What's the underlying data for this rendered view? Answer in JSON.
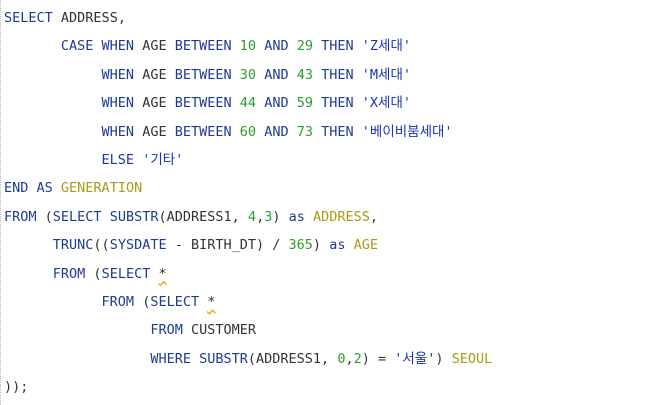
{
  "editor": {
    "lines": [
      [
        {
          "t": "SELECT",
          "c": "kw"
        },
        {
          "t": " ",
          "c": "op"
        },
        {
          "t": "ADDRESS",
          "c": "id"
        },
        {
          "t": ",",
          "c": "op"
        }
      ],
      [
        {
          "t": "       ",
          "c": "op"
        },
        {
          "t": "CASE WHEN",
          "c": "kw"
        },
        {
          "t": " ",
          "c": "op"
        },
        {
          "t": "AGE",
          "c": "id"
        },
        {
          "t": " ",
          "c": "op"
        },
        {
          "t": "BETWEEN",
          "c": "kw"
        },
        {
          "t": " ",
          "c": "op"
        },
        {
          "t": "10",
          "c": "num"
        },
        {
          "t": " ",
          "c": "op"
        },
        {
          "t": "AND",
          "c": "kw"
        },
        {
          "t": " ",
          "c": "op"
        },
        {
          "t": "29",
          "c": "num"
        },
        {
          "t": " ",
          "c": "op"
        },
        {
          "t": "THEN",
          "c": "kw"
        },
        {
          "t": " ",
          "c": "op"
        },
        {
          "t": "'Z세대'",
          "c": "str"
        }
      ],
      [
        {
          "t": "            ",
          "c": "op"
        },
        {
          "t": "WHEN",
          "c": "kw"
        },
        {
          "t": " ",
          "c": "op"
        },
        {
          "t": "AGE",
          "c": "id"
        },
        {
          "t": " ",
          "c": "op"
        },
        {
          "t": "BETWEEN",
          "c": "kw"
        },
        {
          "t": " ",
          "c": "op"
        },
        {
          "t": "30",
          "c": "num"
        },
        {
          "t": " ",
          "c": "op"
        },
        {
          "t": "AND",
          "c": "kw"
        },
        {
          "t": " ",
          "c": "op"
        },
        {
          "t": "43",
          "c": "num"
        },
        {
          "t": " ",
          "c": "op"
        },
        {
          "t": "THEN",
          "c": "kw"
        },
        {
          "t": " ",
          "c": "op"
        },
        {
          "t": "'M세대'",
          "c": "str"
        }
      ],
      [
        {
          "t": "            ",
          "c": "op"
        },
        {
          "t": "WHEN",
          "c": "kw"
        },
        {
          "t": " ",
          "c": "op"
        },
        {
          "t": "AGE",
          "c": "id"
        },
        {
          "t": " ",
          "c": "op"
        },
        {
          "t": "BETWEEN",
          "c": "kw"
        },
        {
          "t": " ",
          "c": "op"
        },
        {
          "t": "44",
          "c": "num"
        },
        {
          "t": " ",
          "c": "op"
        },
        {
          "t": "AND",
          "c": "kw"
        },
        {
          "t": " ",
          "c": "op"
        },
        {
          "t": "59",
          "c": "num"
        },
        {
          "t": " ",
          "c": "op"
        },
        {
          "t": "THEN",
          "c": "kw"
        },
        {
          "t": " ",
          "c": "op"
        },
        {
          "t": "'X세대'",
          "c": "str"
        }
      ],
      [
        {
          "t": "            ",
          "c": "op"
        },
        {
          "t": "WHEN",
          "c": "kw"
        },
        {
          "t": " ",
          "c": "op"
        },
        {
          "t": "AGE",
          "c": "id"
        },
        {
          "t": " ",
          "c": "op"
        },
        {
          "t": "BETWEEN",
          "c": "kw"
        },
        {
          "t": " ",
          "c": "op"
        },
        {
          "t": "60",
          "c": "num"
        },
        {
          "t": " ",
          "c": "op"
        },
        {
          "t": "AND",
          "c": "kw"
        },
        {
          "t": " ",
          "c": "op"
        },
        {
          "t": "73",
          "c": "num"
        },
        {
          "t": " ",
          "c": "op"
        },
        {
          "t": "THEN",
          "c": "kw"
        },
        {
          "t": " ",
          "c": "op"
        },
        {
          "t": "'베이비붐세대'",
          "c": "str"
        }
      ],
      [
        {
          "t": "            ",
          "c": "op"
        },
        {
          "t": "ELSE",
          "c": "kw"
        },
        {
          "t": " ",
          "c": "op"
        },
        {
          "t": "'기타'",
          "c": "str"
        }
      ],
      [
        {
          "t": "END AS",
          "c": "kw"
        },
        {
          "t": " ",
          "c": "op"
        },
        {
          "t": "GENERATION",
          "c": "alias"
        }
      ],
      [
        {
          "t": "FROM",
          "c": "kw"
        },
        {
          "t": " (",
          "c": "op"
        },
        {
          "t": "SELECT",
          "c": "kw"
        },
        {
          "t": " ",
          "c": "op"
        },
        {
          "t": "SUBSTR",
          "c": "kw"
        },
        {
          "t": "(",
          "c": "op"
        },
        {
          "t": "ADDRESS1",
          "c": "id"
        },
        {
          "t": ", ",
          "c": "op"
        },
        {
          "t": "4",
          "c": "num"
        },
        {
          "t": ",",
          "c": "op"
        },
        {
          "t": "3",
          "c": "num"
        },
        {
          "t": ") ",
          "c": "op"
        },
        {
          "t": "as",
          "c": "kw"
        },
        {
          "t": " ",
          "c": "op"
        },
        {
          "t": "ADDRESS",
          "c": "alias"
        },
        {
          "t": ",",
          "c": "op"
        }
      ],
      [
        {
          "t": "      ",
          "c": "op"
        },
        {
          "t": "TRUNC",
          "c": "kw"
        },
        {
          "t": "((",
          "c": "op"
        },
        {
          "t": "SYSDATE",
          "c": "kw"
        },
        {
          "t": " - ",
          "c": "op"
        },
        {
          "t": "BIRTH_DT",
          "c": "id"
        },
        {
          "t": ") / ",
          "c": "op"
        },
        {
          "t": "365",
          "c": "num"
        },
        {
          "t": ") ",
          "c": "op"
        },
        {
          "t": "as",
          "c": "kw"
        },
        {
          "t": " ",
          "c": "op"
        },
        {
          "t": "AGE",
          "c": "alias"
        }
      ],
      [
        {
          "t": "      ",
          "c": "op"
        },
        {
          "t": "FROM",
          "c": "kw"
        },
        {
          "t": " (",
          "c": "op"
        },
        {
          "t": "SELECT",
          "c": "kw"
        },
        {
          "t": " ",
          "c": "op"
        },
        {
          "t": "*",
          "c": "op squig"
        }
      ],
      [
        {
          "t": "            ",
          "c": "op"
        },
        {
          "t": "FROM",
          "c": "kw"
        },
        {
          "t": " (",
          "c": "op"
        },
        {
          "t": "SELECT",
          "c": "kw"
        },
        {
          "t": " ",
          "c": "op"
        },
        {
          "t": "*",
          "c": "op squig"
        }
      ],
      [
        {
          "t": "                  ",
          "c": "op"
        },
        {
          "t": "FROM",
          "c": "kw"
        },
        {
          "t": " ",
          "c": "op"
        },
        {
          "t": "CUSTOMER",
          "c": "id"
        }
      ],
      [
        {
          "t": "                  ",
          "c": "op"
        },
        {
          "t": "WHERE",
          "c": "kw"
        },
        {
          "t": " ",
          "c": "op"
        },
        {
          "t": "SUBSTR",
          "c": "kw"
        },
        {
          "t": "(",
          "c": "op"
        },
        {
          "t": "ADDRESS1",
          "c": "id"
        },
        {
          "t": ", ",
          "c": "op"
        },
        {
          "t": "0",
          "c": "num"
        },
        {
          "t": ",",
          "c": "op"
        },
        {
          "t": "2",
          "c": "num"
        },
        {
          "t": ") = ",
          "c": "op"
        },
        {
          "t": "'서울'",
          "c": "str"
        },
        {
          "t": ") ",
          "c": "op"
        },
        {
          "t": "SEOUL",
          "c": "alias"
        }
      ],
      [
        {
          "t": "));",
          "c": "op"
        }
      ]
    ]
  }
}
